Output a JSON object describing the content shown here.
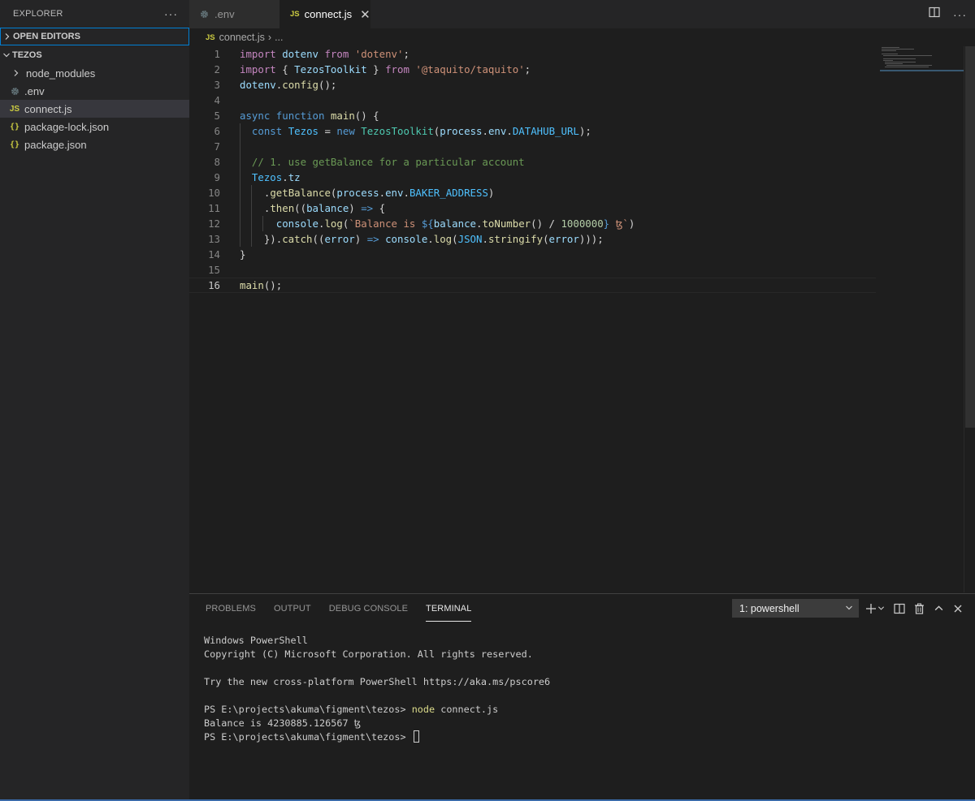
{
  "sidebar": {
    "title": "EXPLORER",
    "more_label": "···",
    "open_editors_label": "OPEN EDITORS",
    "folder_label": "TEZOS",
    "items": [
      {
        "label": "node_modules",
        "icon": "chevron-right-icon"
      },
      {
        "label": ".env",
        "icon": "gear-icon"
      },
      {
        "label": "connect.js",
        "icon": "js-file-icon"
      },
      {
        "label": "package-lock.json",
        "icon": "json-file-icon"
      },
      {
        "label": "package.json",
        "icon": "json-file-icon"
      }
    ]
  },
  "tabs": [
    {
      "label": ".env",
      "active": false
    },
    {
      "label": "connect.js",
      "active": true,
      "close": "✕"
    }
  ],
  "file_icon_text": "JS",
  "json_icon_text": "{}",
  "breadcrumb": {
    "file": "connect.js",
    "separator": "›",
    "ellipsis": "..."
  },
  "editor": {
    "line_numbers": [
      "1",
      "2",
      "3",
      "4",
      "5",
      "6",
      "7",
      "8",
      "9",
      "10",
      "11",
      "12",
      "13",
      "14",
      "15",
      "16"
    ],
    "current_line": 16,
    "lines": [
      [
        {
          "t": "import",
          "c": "ctl"
        },
        {
          "t": " dotenv ",
          "c": "var"
        },
        {
          "t": "from",
          "c": "ctl"
        },
        {
          "t": " ",
          "c": ""
        },
        {
          "t": "'dotenv'",
          "c": "str"
        },
        {
          "t": ";",
          "c": ""
        }
      ],
      [
        {
          "t": "import",
          "c": "ctl"
        },
        {
          "t": " { ",
          "c": ""
        },
        {
          "t": "TezosToolkit",
          "c": "var"
        },
        {
          "t": " } ",
          "c": ""
        },
        {
          "t": "from",
          "c": "ctl"
        },
        {
          "t": " ",
          "c": ""
        },
        {
          "t": "'@taquito/taquito'",
          "c": "str"
        },
        {
          "t": ";",
          "c": ""
        }
      ],
      [
        {
          "t": "dotenv",
          "c": "var"
        },
        {
          "t": ".",
          "c": ""
        },
        {
          "t": "config",
          "c": "fn"
        },
        {
          "t": "();",
          "c": ""
        }
      ],
      [],
      [
        {
          "t": "async",
          "c": "kw"
        },
        {
          "t": " ",
          "c": ""
        },
        {
          "t": "function",
          "c": "kw"
        },
        {
          "t": " ",
          "c": ""
        },
        {
          "t": "main",
          "c": "fn"
        },
        {
          "t": "() {",
          "c": ""
        }
      ],
      [
        {
          "t": "  ",
          "c": ""
        },
        {
          "t": "const",
          "c": "kw"
        },
        {
          "t": " ",
          "c": ""
        },
        {
          "t": "Tezos",
          "c": "cst"
        },
        {
          "t": " = ",
          "c": ""
        },
        {
          "t": "new",
          "c": "kw"
        },
        {
          "t": " ",
          "c": ""
        },
        {
          "t": "TezosToolkit",
          "c": "cls"
        },
        {
          "t": "(",
          "c": ""
        },
        {
          "t": "process",
          "c": "var"
        },
        {
          "t": ".",
          "c": ""
        },
        {
          "t": "env",
          "c": "var"
        },
        {
          "t": ".",
          "c": ""
        },
        {
          "t": "DATAHUB_URL",
          "c": "cst"
        },
        {
          "t": ");",
          "c": ""
        }
      ],
      [],
      [
        {
          "t": "  ",
          "c": ""
        },
        {
          "t": "// 1. use getBalance for a particular account",
          "c": "cmt"
        }
      ],
      [
        {
          "t": "  ",
          "c": ""
        },
        {
          "t": "Tezos",
          "c": "cst"
        },
        {
          "t": ".",
          "c": ""
        },
        {
          "t": "tz",
          "c": "var"
        }
      ],
      [
        {
          "t": "    .",
          "c": ""
        },
        {
          "t": "getBalance",
          "c": "fn"
        },
        {
          "t": "(",
          "c": ""
        },
        {
          "t": "process",
          "c": "var"
        },
        {
          "t": ".",
          "c": ""
        },
        {
          "t": "env",
          "c": "var"
        },
        {
          "t": ".",
          "c": ""
        },
        {
          "t": "BAKER_ADDRESS",
          "c": "cst"
        },
        {
          "t": ")",
          "c": ""
        }
      ],
      [
        {
          "t": "    .",
          "c": ""
        },
        {
          "t": "then",
          "c": "fn"
        },
        {
          "t": "((",
          "c": ""
        },
        {
          "t": "balance",
          "c": "var"
        },
        {
          "t": ") ",
          "c": ""
        },
        {
          "t": "=>",
          "c": "kw"
        },
        {
          "t": " {",
          "c": ""
        }
      ],
      [
        {
          "t": "      ",
          "c": ""
        },
        {
          "t": "console",
          "c": "var"
        },
        {
          "t": ".",
          "c": ""
        },
        {
          "t": "log",
          "c": "fn"
        },
        {
          "t": "(",
          "c": ""
        },
        {
          "t": "`Balance is ",
          "c": "str"
        },
        {
          "t": "${",
          "c": "tmpl"
        },
        {
          "t": "balance",
          "c": "var"
        },
        {
          "t": ".",
          "c": ""
        },
        {
          "t": "toNumber",
          "c": "fn"
        },
        {
          "t": "() / ",
          "c": ""
        },
        {
          "t": "1000000",
          "c": "num"
        },
        {
          "t": "}",
          "c": "tmpl"
        },
        {
          "t": " ꜩ`",
          "c": "str"
        },
        {
          "t": ")",
          "c": ""
        }
      ],
      [
        {
          "t": "    }).",
          "c": ""
        },
        {
          "t": "catch",
          "c": "fn"
        },
        {
          "t": "((",
          "c": ""
        },
        {
          "t": "error",
          "c": "var"
        },
        {
          "t": ") ",
          "c": ""
        },
        {
          "t": "=>",
          "c": "kw"
        },
        {
          "t": " ",
          "c": ""
        },
        {
          "t": "console",
          "c": "var"
        },
        {
          "t": ".",
          "c": ""
        },
        {
          "t": "log",
          "c": "fn"
        },
        {
          "t": "(",
          "c": ""
        },
        {
          "t": "JSON",
          "c": "cst"
        },
        {
          "t": ".",
          "c": ""
        },
        {
          "t": "stringify",
          "c": "fn"
        },
        {
          "t": "(",
          "c": ""
        },
        {
          "t": "error",
          "c": "var"
        },
        {
          "t": ")));",
          "c": ""
        }
      ],
      [
        {
          "t": "}",
          "c": ""
        }
      ],
      [],
      [
        {
          "t": "main",
          "c": "fn"
        },
        {
          "t": "();",
          "c": ""
        }
      ]
    ]
  },
  "panel": {
    "tabs": [
      "PROBLEMS",
      "OUTPUT",
      "DEBUG CONSOLE",
      "TERMINAL"
    ],
    "active_tab": "TERMINAL",
    "terminal_select": "1: powershell",
    "terminal_lines": [
      {
        "text": "Windows PowerShell"
      },
      {
        "text": "Copyright (C) Microsoft Corporation. All rights reserved."
      },
      {
        "text": ""
      },
      {
        "text": "Try the new cross-platform PowerShell https://aka.ms/pscore6"
      },
      {
        "text": ""
      },
      {
        "prompt": "PS E:\\projects\\akuma\\figment\\tezos> ",
        "command": "node",
        "args": " connect.js"
      },
      {
        "text": "Balance is 4230885.126567 ꜩ"
      },
      {
        "prompt": "PS E:\\projects\\akuma\\figment\\tezos> ",
        "cursor": true
      }
    ]
  },
  "colors": {
    "accent": "#007fd4",
    "js_icon": "#cbcb41",
    "status_line": "#3a6aa8"
  }
}
